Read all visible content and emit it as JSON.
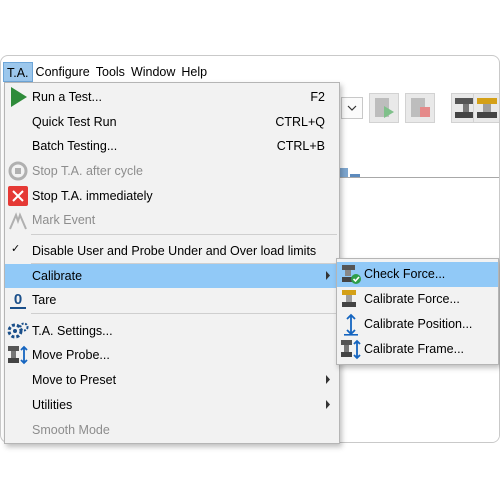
{
  "menubar": {
    "items": [
      {
        "label": "T.A."
      },
      {
        "label": "Configure"
      },
      {
        "label": "Tools"
      },
      {
        "label": "Window"
      },
      {
        "label": "Help"
      }
    ]
  },
  "main_menu": {
    "items": [
      {
        "label": "Run a Test...",
        "shortcut": "F2",
        "icon": "play-icon",
        "enabled": true
      },
      {
        "label": "Quick Test Run",
        "shortcut": "CTRL+Q",
        "enabled": true
      },
      {
        "label": "Batch Testing...",
        "shortcut": "CTRL+B",
        "enabled": true
      },
      {
        "label": "Stop T.A. after cycle",
        "icon": "cycle-stop-icon",
        "enabled": false
      },
      {
        "label": "Stop T.A. immediately",
        "icon": "red-x-icon",
        "enabled": true
      },
      {
        "label": "Mark Event",
        "icon": "mark-event-icon",
        "enabled": false
      },
      {
        "label": "Disable User and Probe Under and Over load limits",
        "checked": true,
        "enabled": true
      },
      {
        "label": "Calibrate",
        "submenu": true,
        "highlighted": true,
        "enabled": true
      },
      {
        "label": "Tare",
        "icon": "tare-zero-icon",
        "enabled": true
      },
      {
        "label": "T.A. Settings...",
        "icon": "settings-gears-icon",
        "enabled": true
      },
      {
        "label": "Move Probe...",
        "icon": "move-probe-icon",
        "enabled": true
      },
      {
        "label": "Move to Preset",
        "submenu": true,
        "enabled": true
      },
      {
        "label": "Utilities",
        "submenu": true,
        "enabled": true
      },
      {
        "label": "Smooth Mode",
        "enabled": false
      }
    ]
  },
  "calibrate_submenu": {
    "items": [
      {
        "label": "Check Force...",
        "icon": "check-force-icon",
        "highlighted": true
      },
      {
        "label": "Calibrate Force...",
        "icon": "calibrate-force-icon"
      },
      {
        "label": "Calibrate Position...",
        "icon": "calibrate-position-icon"
      },
      {
        "label": "Calibrate Frame...",
        "icon": "calibrate-frame-icon"
      }
    ]
  },
  "colors": {
    "highlight": "#91c9f7",
    "menu_bg": "#f2f2f2",
    "play_green": "#2e8b3a",
    "stop_red": "#e53935",
    "accent_blue": "#1565c0"
  }
}
